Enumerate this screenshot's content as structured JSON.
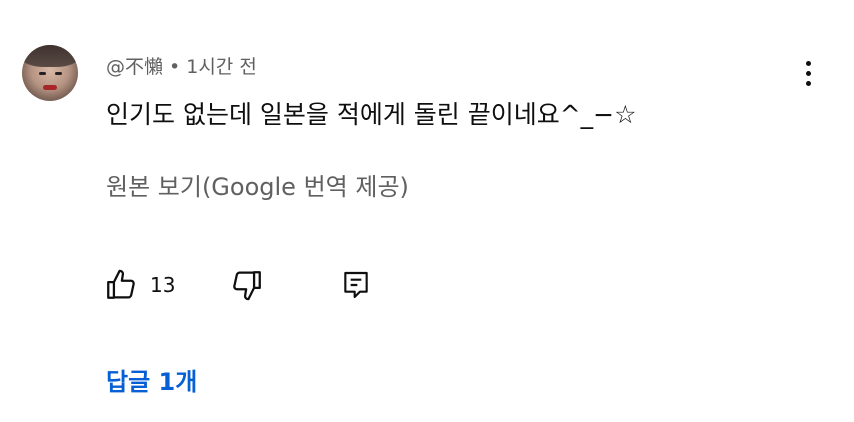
{
  "comment": {
    "author": "@不懶",
    "separator": "•",
    "time": "1시간 전",
    "text": "인기도 없는데 일본을 적에게 돌린 끝이네요^_−☆",
    "translate_link": "원본 보기(Google 번역 제공)",
    "like_count": "13",
    "replies_label": "답글 1개"
  },
  "icons": {
    "avatar": "user-avatar",
    "like": "thumbs-up-icon",
    "dislike": "thumbs-down-icon",
    "reply": "reply-comment-icon",
    "menu": "more-vertical-icon"
  },
  "colors": {
    "text": "#0f0f0f",
    "secondary": "#606060",
    "link": "#065fd4"
  }
}
